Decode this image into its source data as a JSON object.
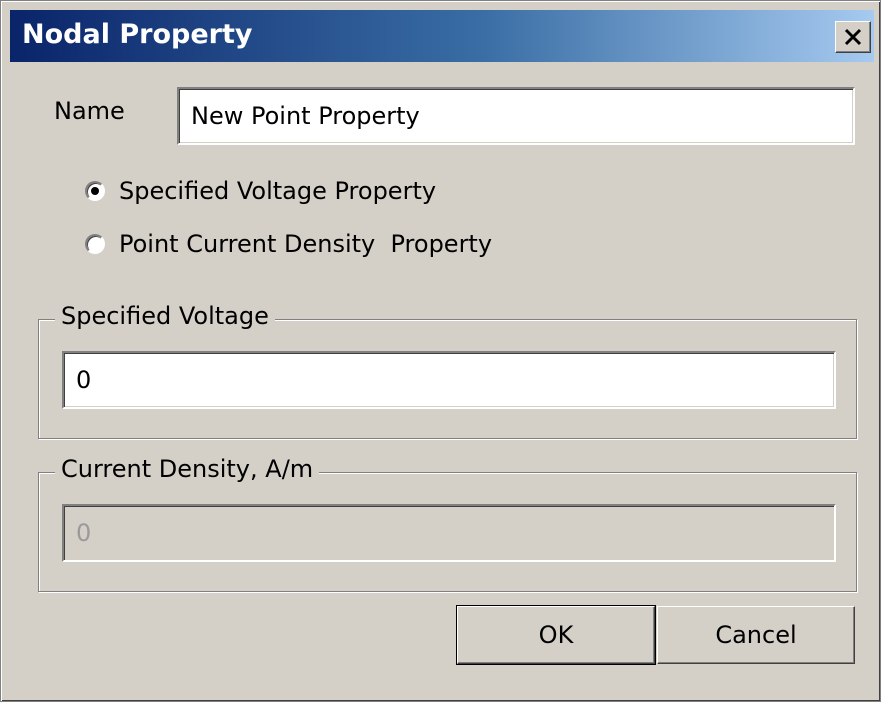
{
  "window": {
    "title": "Nodal Property"
  },
  "name_field": {
    "label": "Name",
    "value": "New Point Property"
  },
  "property_type": {
    "options": [
      {
        "label": "Specified Voltage Property",
        "selected": true
      },
      {
        "label": "Point Current Density  Property",
        "selected": false
      }
    ]
  },
  "voltage_group": {
    "title": "Specified Voltage",
    "value": "0",
    "enabled": true
  },
  "current_group": {
    "title": "Current Density, A/m",
    "value": "0",
    "enabled": false
  },
  "buttons": {
    "ok": "OK",
    "cancel": "Cancel"
  },
  "icons": {
    "close": "close-icon"
  },
  "colors": {
    "titlebar_start": "#0a246a",
    "titlebar_end": "#a6caf0",
    "dialog_bg": "#d4d0c8"
  }
}
